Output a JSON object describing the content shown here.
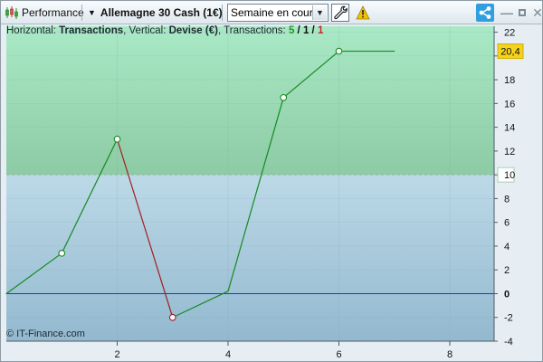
{
  "toolbar": {
    "app_label": "Performance",
    "instrument_label": "Allemagne 30 Cash (1€)",
    "period_select_value": "Semaine en cours",
    "colors": {
      "share_button": "#2f9fe0",
      "warning": "#f2c200"
    },
    "icons": {
      "performance": "candlestick-icon",
      "instrument_dropdown": "chevron-down-icon",
      "settings": "wrench-icon",
      "warning": "warning-icon",
      "share": "share-icon",
      "minimize": "minimize-icon",
      "maximize": "maximize-icon",
      "close": "close-icon"
    }
  },
  "legend": {
    "horizontal_prefix": "Horizontal: ",
    "horizontal_value": "Transactions",
    "vertical_prefix": ", Vertical: ",
    "vertical_value": "Devise (€)",
    "transactions_prefix": ", Transactions: ",
    "transactions_green": "5",
    "separator_1": " / ",
    "transactions_black": "1",
    "separator_2": " / ",
    "transactions_red": "1"
  },
  "copyright": "© IT-Finance.com",
  "chart_data": {
    "type": "line",
    "x": [
      0,
      1,
      2,
      3,
      4,
      5,
      6,
      7
    ],
    "series": [
      {
        "values": [
          0,
          3.4,
          13,
          -2,
          0.2,
          16.5,
          20.4,
          20.4
        ],
        "segment_colors": [
          "#168a21",
          "#168a21",
          "#a11e1e",
          "#168a21",
          "#168a21",
          "#168a21",
          "#168a21"
        ]
      }
    ],
    "x_ticks": [
      2,
      4,
      6,
      8
    ],
    "y_ticks": [
      22,
      20,
      18,
      16,
      14,
      12,
      10,
      8,
      6,
      4,
      2,
      0,
      -2,
      -4
    ],
    "y_labels": [
      "22",
      "20,4",
      "18",
      "16",
      "14",
      "12",
      "10",
      "8",
      "6",
      "4",
      "2",
      "0",
      "-2",
      "-4"
    ],
    "markers_x": [
      1,
      2,
      3,
      5,
      6
    ],
    "xlim": [
      0,
      8.8
    ],
    "ylim": [
      -4,
      22.5
    ],
    "reference_lines": [
      {
        "value": 0,
        "color": "#1437ff"
      },
      {
        "value": 10,
        "color": "#9bb2a8"
      }
    ],
    "region_colors": {
      "upper_top": "#a9e9c5",
      "upper_bottom": "#8dcba5",
      "lower_top": "#bcd9e7",
      "lower_bottom": "#93b9cf"
    },
    "grid": true,
    "legend_placement": "top-left"
  }
}
